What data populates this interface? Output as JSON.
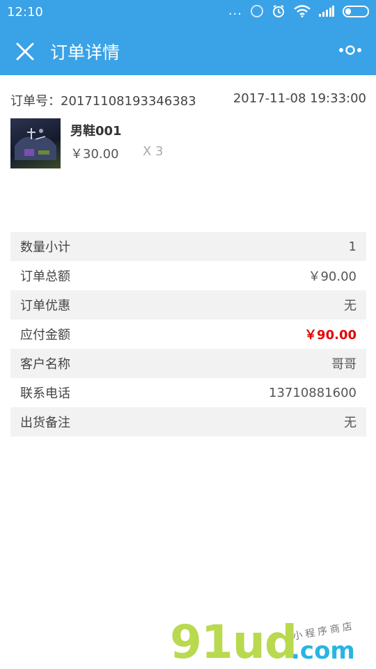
{
  "status_bar": {
    "time": "12:10",
    "dots": "...",
    "icons": [
      "sync-icon",
      "alarm-icon",
      "wifi-icon",
      "signal-icon",
      "battery-icon"
    ]
  },
  "nav": {
    "title": "订单详情",
    "close_icon": "close-icon",
    "more_icon": "more-icon"
  },
  "order": {
    "number_label": "订单号：20171108193346383",
    "time": "2017-11-08 19:33:00"
  },
  "product": {
    "name": "男鞋001",
    "price": "￥30.00",
    "quantity": "X 3"
  },
  "summary": [
    {
      "label": "数量小计",
      "value": "1"
    },
    {
      "label": "订单总额",
      "value": "￥90.00"
    },
    {
      "label": "订单优惠",
      "value": "无"
    },
    {
      "label": "应付金额",
      "value": "￥90.00"
    },
    {
      "label": "客户名称",
      "value": "哥哥"
    },
    {
      "label": "联系电话",
      "value": "13710881600"
    },
    {
      "label": "出货备注",
      "value": "无"
    }
  ],
  "watermark": {
    "logo": "91ud",
    "domain": ".com",
    "subtitle": "小程序商店"
  },
  "colors": {
    "brand": "#3aa2e6",
    "price_highlight": "#e30000",
    "row_shade": "#f2f2f2"
  }
}
